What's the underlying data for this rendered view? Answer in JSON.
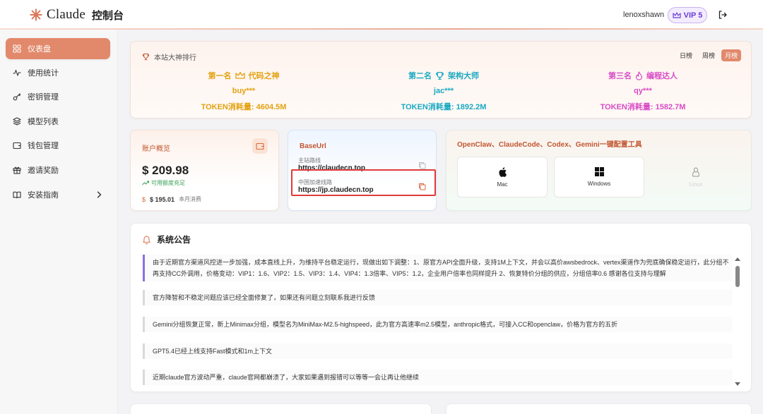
{
  "header": {
    "brand": "Claude",
    "title": "控制台",
    "username": "lenoxshawn",
    "vip_label": "VIP 5"
  },
  "sidebar": {
    "items": [
      {
        "label": "仪表盘",
        "icon": "dashboard-icon",
        "active": true
      },
      {
        "label": "使用统计",
        "icon": "chart-line-icon"
      },
      {
        "label": "密钥管理",
        "icon": "key-icon"
      },
      {
        "label": "模型列表",
        "icon": "layers-icon"
      },
      {
        "label": "钱包管理",
        "icon": "wallet-icon"
      },
      {
        "label": "邀请奖励",
        "icon": "gift-icon"
      },
      {
        "label": "安装指南",
        "icon": "book-icon",
        "expandable": true
      }
    ]
  },
  "ranking": {
    "title": "本站大神排行",
    "tabs": [
      "日榜",
      "周榜",
      "月榜"
    ],
    "active_tab": "月榜",
    "entries": [
      {
        "place": "第一名",
        "badge": "代码之神",
        "user": "buy***",
        "token_text": "TOKEN消耗量: 4604.5M",
        "color": "#e3a10f"
      },
      {
        "place": "第二名",
        "badge": "架构大师",
        "user": "jac***",
        "token_text": "TOKEN消耗量: 1892.2M",
        "color": "#1ba9c3"
      },
      {
        "place": "第三名",
        "badge": "编程达人",
        "user": "qy***",
        "token_text": "TOKEN消耗量: 1582.7M",
        "color": "#d94bc6"
      }
    ]
  },
  "account": {
    "title": "账户概览",
    "balance": "$ 209.98",
    "status": "可用额度充足",
    "spent_amount": "$ 195.01",
    "spent_label": "本月消费"
  },
  "baseurl": {
    "title": "BaseUrl",
    "routes": [
      {
        "label": "主站路线",
        "url": "https://claudecn.top"
      },
      {
        "label": "中国加速线路",
        "url": "https://jp.claudecn.top"
      }
    ]
  },
  "tools": {
    "title": "OpenClaw、ClaudeCode、Codex、Gemini一键配置工具",
    "os": [
      {
        "label": "Mac",
        "icon": "apple-icon"
      },
      {
        "label": "Windows",
        "icon": "windows-icon"
      },
      {
        "label": "Linux",
        "icon": "linux-icon"
      }
    ]
  },
  "notice": {
    "title": "系统公告",
    "items": [
      "由于近期官方渠道风控进一步加强，成本直线上升，为维持平台稳定运行，现做出如下调整：1、原官方API全面升级，支持1M上下文，并会以高价awsbedrock、vertex渠道作为兜底确保稳定运行，此分组不再支持CC外调用，价格变动：VIP1：1.6、VIP2：1.5、VIP3：1.4、VIP4：1.3倍率、VIP5：1.2，企业用户倍率也同样提升 2、恢复特价分组的供应，分组倍率0.6 感谢各位支持与理解",
      "官方降智和不稳定问题应该已经全面修复了，如果还有问题立刻联系我进行反馈",
      "Gemini分组恢复正常，新上Minimax分组，模型名为MiniMax-M2.5-highspeed，此为官方高速率m2.5模型，anthropic格式，可接入CC和openclaw，价格为官方的五折",
      "GPT5.4已经上线支持Fast模式和1m上下文",
      "近期claude官方波动严重，claude官网都崩溃了，大家如果遇到报错可以等等一会让再让他继续"
    ]
  },
  "colors": {
    "accent": "#e2896c",
    "gold": "#e3a10f",
    "teal": "#1ba9c3",
    "pink": "#d94bc6",
    "highlight": "#e23a3a"
  }
}
